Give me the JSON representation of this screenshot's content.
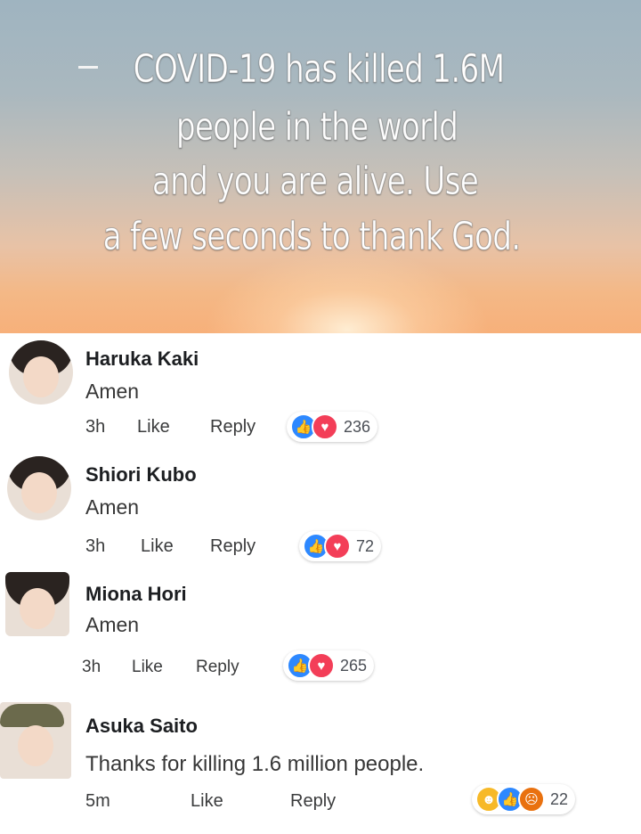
{
  "post": {
    "headline": [
      "COVID-19 has killed 1.6M",
      "people in the world",
      "and you are alive. Use",
      "a few seconds to thank God."
    ]
  },
  "comments": [
    {
      "name": "Haruka Kaki",
      "text": "Amen",
      "time": "3h",
      "like": "Like",
      "reply": "Reply",
      "reaction_count": "236",
      "reactions": [
        "like-icon",
        "love-icon"
      ]
    },
    {
      "name": "Shiori Kubo",
      "text": "Amen",
      "time": "3h",
      "like": "Like",
      "reply": "Reply",
      "reaction_count": "72",
      "reactions": [
        "like-icon",
        "love-icon"
      ]
    },
    {
      "name": "Miona Hori",
      "text": "Amen",
      "time": "3h",
      "like": "Like",
      "reply": "Reply",
      "reaction_count": "265",
      "reactions": [
        "like-icon",
        "love-icon"
      ]
    },
    {
      "name": "Asuka Saito",
      "text": "Thanks for killing 1.6 million people.",
      "time": "5m",
      "like": "Like",
      "reply": "Reply",
      "reaction_count": "22",
      "reactions": [
        "haha-icon",
        "like-icon",
        "angry-icon"
      ]
    }
  ],
  "colors": {
    "like": "#2d88ff",
    "love": "#f33e58",
    "haha": "#f7b928",
    "angry": "#e9710f"
  }
}
